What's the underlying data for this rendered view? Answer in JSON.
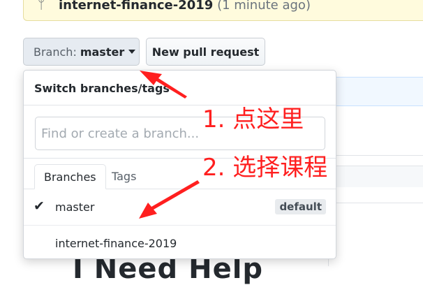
{
  "flash": {
    "branch": "internet-finance-2019",
    "time": "(1 minute ago)",
    "icon": "git-branch-icon"
  },
  "toolbar": {
    "branch_prefix": "Branch:",
    "branch_name": "master",
    "new_pr_label": "New pull request"
  },
  "dropdown": {
    "title": "Switch branches/tags",
    "filter_placeholder": "Find or create a branch...",
    "tabs": [
      {
        "label": "Branches"
      },
      {
        "label": "Tags"
      }
    ],
    "items": [
      {
        "label": "master",
        "selected": true,
        "badge": "default"
      },
      {
        "label": "internet-finance-2019",
        "selected": false
      }
    ]
  },
  "background": {
    "heading": "I Need Help"
  },
  "annotations": {
    "step1": "1. 点这里",
    "step2": "2. 选择课程",
    "color": "#ff1f1f"
  }
}
